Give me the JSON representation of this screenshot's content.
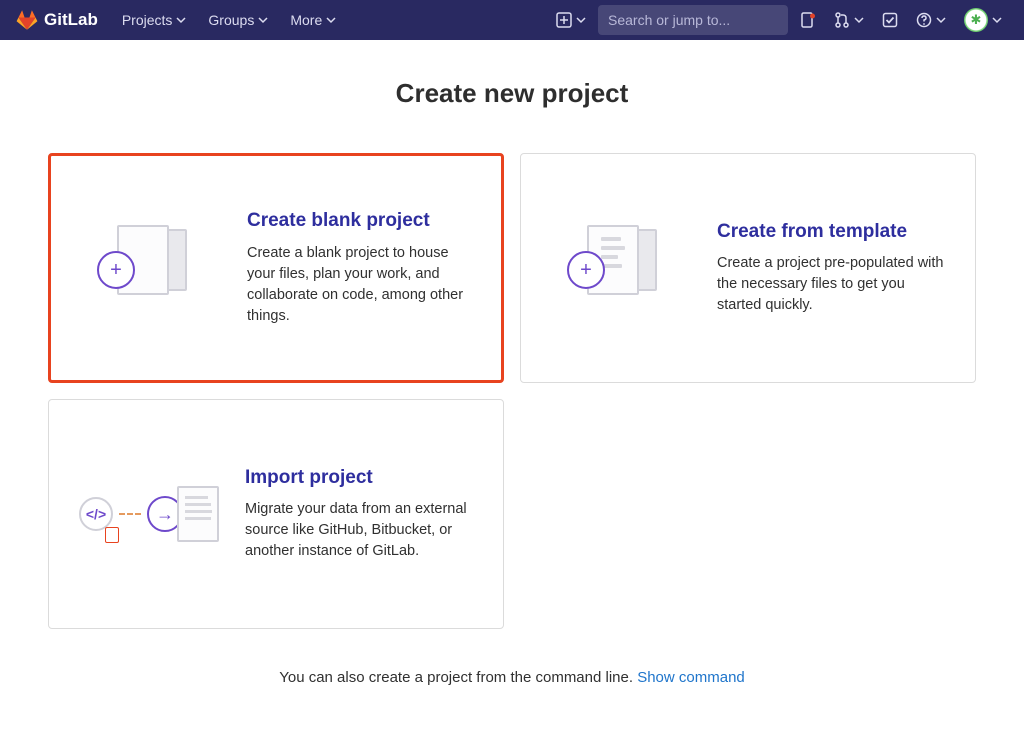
{
  "brand": "GitLab",
  "nav": {
    "projects": "Projects",
    "groups": "Groups",
    "more": "More"
  },
  "search": {
    "placeholder": "Search or jump to..."
  },
  "page_title": "Create new project",
  "cards": {
    "blank": {
      "title": "Create blank project",
      "desc": "Create a blank project to house your files, plan your work, and collaborate on code, among other things."
    },
    "template": {
      "title": "Create from template",
      "desc": "Create a project pre-populated with the necessary files to get you started quickly."
    },
    "import": {
      "title": "Import project",
      "desc": "Migrate your data from an external source like GitHub, Bitbucket, or another instance of GitLab."
    }
  },
  "footer": {
    "text": "You can also create a project from the command line. ",
    "link": "Show command"
  }
}
